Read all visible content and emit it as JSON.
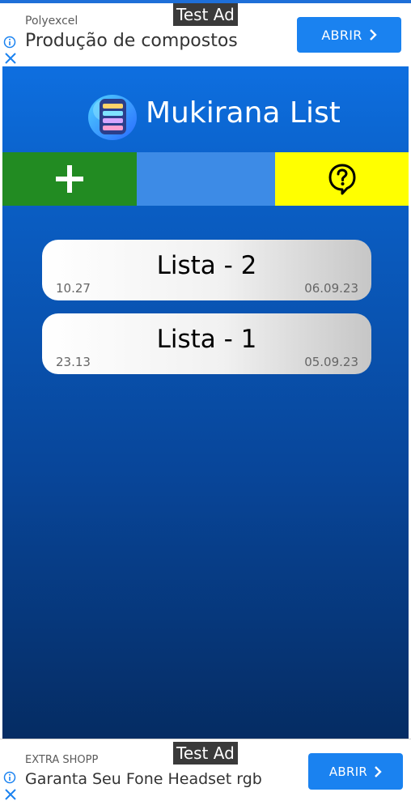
{
  "ads": {
    "top": {
      "tag": "Test Ad",
      "advertiser": "Polyexcel",
      "headline": "Produção de compostos",
      "cta": "ABRIR"
    },
    "bottom": {
      "tag": "Test Ad",
      "advertiser": "EXTRA SHOPP",
      "headline": "Garanta Seu Fone Headset rgb",
      "cta": "ABRIR"
    }
  },
  "app": {
    "title": "Mukirana List",
    "colors": {
      "background_top": "#0e6fe0",
      "background_bottom": "#052c63",
      "add_button": "#228b22",
      "middle_button": "#3d8be6",
      "help_button": "#ffff00"
    },
    "toolbar": {
      "add_icon": "plus-icon",
      "help_icon": "question-bubble-icon"
    },
    "lists": [
      {
        "name": "Lista - 2",
        "total": "10.27",
        "date": "06.09.23"
      },
      {
        "name": "Lista - 1",
        "total": "23.13",
        "date": "05.09.23"
      }
    ]
  }
}
